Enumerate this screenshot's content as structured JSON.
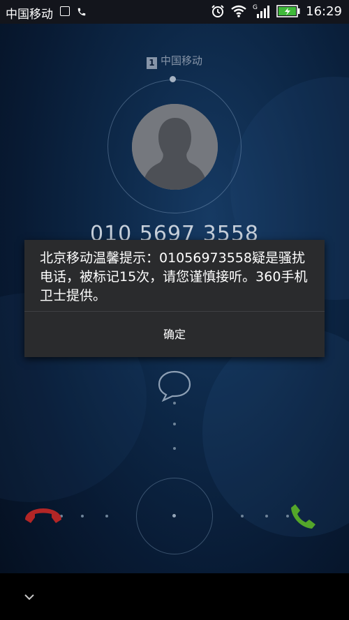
{
  "status_bar": {
    "carrier": "中国移动",
    "photo_icon": "image-icon",
    "phone_icon": "phone-icon",
    "alarm_icon": "alarm-icon",
    "wifi_icon": "wifi-icon",
    "network_type": "G",
    "signal_icon": "signal-icon",
    "battery_icon": "battery-charging-icon",
    "time": "16:29"
  },
  "sim": {
    "slot": "1",
    "carrier": "中国移动"
  },
  "caller": {
    "number": "010 5697 3558",
    "avatar_icon": "person-silhouette-icon"
  },
  "dialog": {
    "message": "北京移动温馨提示：01056973558疑是骚扰电话，被标记15次，请您谨慎接听。360手机卫士提供。",
    "confirm_label": "确定"
  },
  "controls": {
    "message_icon": "chat-bubble-icon",
    "decline_icon": "decline-call-icon",
    "answer_icon": "answer-call-icon"
  },
  "nav": {
    "collapse_icon": "chevron-down-icon"
  },
  "colors": {
    "decline": "#b32626",
    "answer": "#54a62a",
    "dialog_bg": "#2a2b2d",
    "status_bar_bg": "#13151c"
  }
}
